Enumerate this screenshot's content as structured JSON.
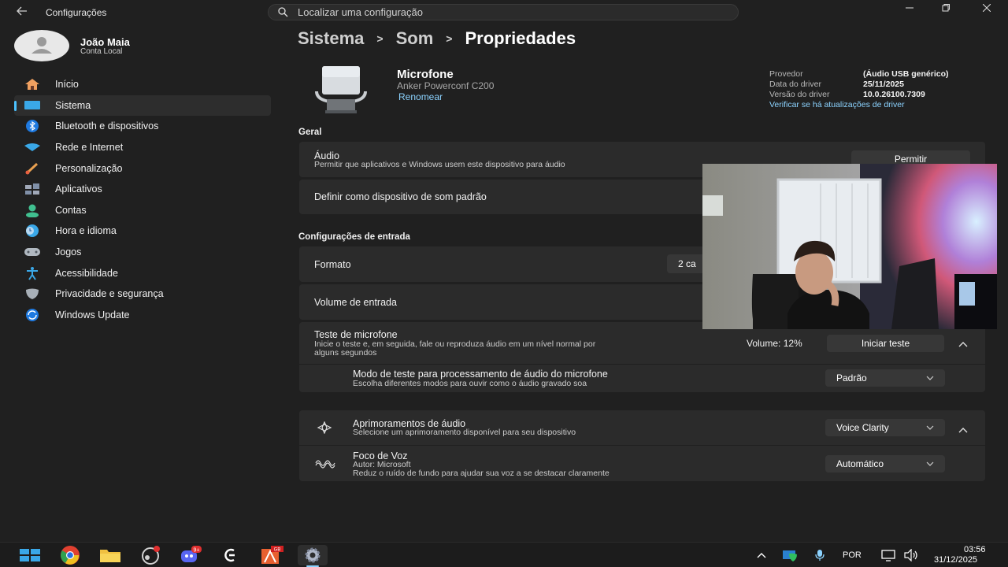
{
  "titlebar": {
    "app_title": "Configurações",
    "search_placeholder": "Localizar uma configuração"
  },
  "user": {
    "name": "João Maia",
    "account_type": "Conta Local"
  },
  "nav": [
    {
      "label": "Início",
      "icon": "home-icon"
    },
    {
      "label": "Sistema",
      "icon": "system-icon",
      "active": true
    },
    {
      "label": "Bluetooth e dispositivos",
      "icon": "bluetooth-icon"
    },
    {
      "label": "Rede e Internet",
      "icon": "wifi-icon"
    },
    {
      "label": "Personalização",
      "icon": "brush-icon"
    },
    {
      "label": "Aplicativos",
      "icon": "apps-icon"
    },
    {
      "label": "Contas",
      "icon": "accounts-icon"
    },
    {
      "label": "Hora e idioma",
      "icon": "clock-globe-icon"
    },
    {
      "label": "Jogos",
      "icon": "gamepad-icon"
    },
    {
      "label": "Acessibilidade",
      "icon": "accessibility-icon"
    },
    {
      "label": "Privacidade e segurança",
      "icon": "shield-icon"
    },
    {
      "label": "Windows Update",
      "icon": "update-icon"
    }
  ],
  "breadcrumb": [
    "Sistema",
    "Som",
    "Propriedades"
  ],
  "device": {
    "name": "Microfone",
    "model": "Anker Powerconf C200",
    "rename_link": "Renomear"
  },
  "driver": {
    "provider_label": "Provedor",
    "provider_value": "(Áudio USB genérico)",
    "date_label": "Data do driver",
    "date_value": "25/11/2025",
    "version_label": "Versão do driver",
    "version_value": "10.0.26100.7309",
    "check_link": "Verificar se há atualizações de driver"
  },
  "general": {
    "heading": "Geral",
    "audio_title": "Áudio",
    "audio_desc": "Permitir que aplicativos e Windows usem este dispositivo para áudio",
    "audio_button": "Permitir",
    "default_title": "Definir como dispositivo de som padrão"
  },
  "input_settings": {
    "heading": "Configurações de entrada",
    "format_title": "Formato",
    "format_value": "2 ca",
    "volume_title": "Volume de entrada",
    "test_title": "Teste de microfone",
    "test_desc_1": "Inicie o teste e, em seguida, fale ou reproduza áudio em um nível normal por",
    "test_desc_2": "alguns segundos",
    "test_volume": "Volume: 12%",
    "test_button": "Iniciar teste",
    "mode_title": "Modo de teste para processamento de áudio do microfone",
    "mode_desc": "Escolha diferentes modos para ouvir como o áudio gravado soa",
    "mode_value": "Padrão"
  },
  "enhancements": {
    "title": "Aprimoramentos de áudio",
    "desc": "Selecione um aprimoramento disponível para seu dispositivo",
    "value": "Voice Clarity",
    "voice_title": "Foco de Voz",
    "voice_author": "Autor: Microsoft",
    "voice_desc": "Reduz o ruído de fundo para ajudar sua voz a se destacar claramente",
    "voice_value": "Automático"
  },
  "taskbar": {
    "language": "POR",
    "time": "03:56",
    "date": "31/12/2025",
    "discord_badge": "9+",
    "app_badge": "GB"
  },
  "colors": {
    "background": "#202020",
    "card": "#2b2b2b",
    "accent": "#4cc2ff",
    "link": "#8cd3ff"
  }
}
